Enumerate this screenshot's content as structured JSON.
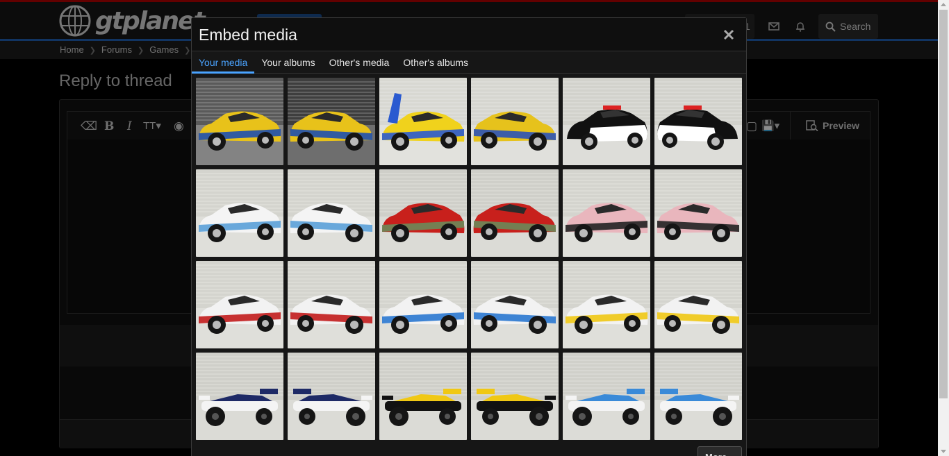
{
  "site": {
    "logo_text": "gtplanet",
    "user_count": "1",
    "search_label": "Search",
    "accent_red": "#b40000",
    "accent_blue": "#1f5fb3"
  },
  "breadcrumb": [
    "Home",
    "Forums",
    "Games"
  ],
  "page": {
    "title": "Reply to thread",
    "preview_label": "Preview"
  },
  "modal": {
    "title": "Embed media",
    "close_icon": "close-icon",
    "tabs": [
      {
        "label": "Your media",
        "active": true
      },
      {
        "label": "Your albums",
        "active": false
      },
      {
        "label": "Other's media",
        "active": false
      },
      {
        "label": "Other's albums",
        "active": false
      }
    ],
    "more_label": "More...",
    "tab_active_color": "#4aa3ff",
    "media": [
      {
        "kind": "muscle",
        "body": "#e8c21a",
        "accent": "#1d4fb0",
        "bg": "#5a5a5a",
        "num": "28"
      },
      {
        "kind": "muscle",
        "body": "#e8c21a",
        "accent": "#1d4fb0",
        "bg": "#3e3e3e",
        "num": "28"
      },
      {
        "kind": "superbird",
        "body": "#f0d21c",
        "accent": "#2a5ad0",
        "bg": "#d8d8d2",
        "num": ""
      },
      {
        "kind": "muscle",
        "body": "#e6c21c",
        "accent": "#2a52b8",
        "bg": "#d6d6d0",
        "num": "28"
      },
      {
        "kind": "police",
        "body": "#ffffff",
        "accent": "#111111",
        "bg": "#d2d2cc",
        "num": "POLICE"
      },
      {
        "kind": "police",
        "body": "#ffffff",
        "accent": "#111111",
        "bg": "#d2d2cc",
        "num": "POLICE"
      },
      {
        "kind": "porsche",
        "body": "#f4f4f4",
        "accent": "#5aa0d8",
        "bg": "#d4d4ce",
        "num": "99"
      },
      {
        "kind": "porsche",
        "body": "#f4f4f4",
        "accent": "#5aa0d8",
        "bg": "#d4d4ce",
        "num": "99"
      },
      {
        "kind": "rx7",
        "body": "#c8201c",
        "accent": "#6a8a5a",
        "bg": "#cfcfc9",
        "num": ""
      },
      {
        "kind": "rx7",
        "body": "#c8201c",
        "accent": "#6a8a5a",
        "bg": "#cfcfc9",
        "num": ""
      },
      {
        "kind": "beat",
        "body": "#e9b6bd",
        "accent": "#222222",
        "bg": "#d4d4ce",
        "num": ""
      },
      {
        "kind": "beat",
        "body": "#e9b6bd",
        "accent": "#222222",
        "bg": "#d4d4ce",
        "num": ""
      },
      {
        "kind": "sports800",
        "body": "#f2f2f2",
        "accent": "#c21c1c",
        "bg": "#d4d4ce",
        "num": "9"
      },
      {
        "kind": "sports800",
        "body": "#f2f2f2",
        "accent": "#c21c1c",
        "bg": "#d4d4ce",
        "num": "9"
      },
      {
        "kind": "sports800",
        "body": "#f2f2f2",
        "accent": "#2a78d0",
        "bg": "#d4d4ce",
        "num": "8"
      },
      {
        "kind": "sports800",
        "body": "#f2f2f2",
        "accent": "#2a78d0",
        "bg": "#d4d4ce",
        "num": "8"
      },
      {
        "kind": "sports800",
        "body": "#f2f2f2",
        "accent": "#f0c814",
        "bg": "#d4d4ce",
        "num": "6"
      },
      {
        "kind": "sports800",
        "body": "#f2f2f2",
        "accent": "#f0c814",
        "bg": "#d4d4ce",
        "num": "6"
      },
      {
        "kind": "f1",
        "body": "#f4f4f4",
        "accent": "#1e2a66",
        "bg": "#cfcfc9",
        "num": "5"
      },
      {
        "kind": "f1",
        "body": "#f4f4f4",
        "accent": "#1e2a66",
        "bg": "#cfcfc9",
        "num": "5"
      },
      {
        "kind": "f1",
        "body": "#111111",
        "accent": "#f0c814",
        "bg": "#cfcfc9",
        "num": "29"
      },
      {
        "kind": "f1",
        "body": "#111111",
        "accent": "#f0c814",
        "bg": "#cfcfc9",
        "num": "29"
      },
      {
        "kind": "f1",
        "body": "#f4f4f4",
        "accent": "#3a8ad8",
        "bg": "#d0d0ca",
        "num": "36"
      },
      {
        "kind": "f1",
        "body": "#f4f4f4",
        "accent": "#3a8ad8",
        "bg": "#d0d0ca",
        "num": "36"
      }
    ]
  }
}
